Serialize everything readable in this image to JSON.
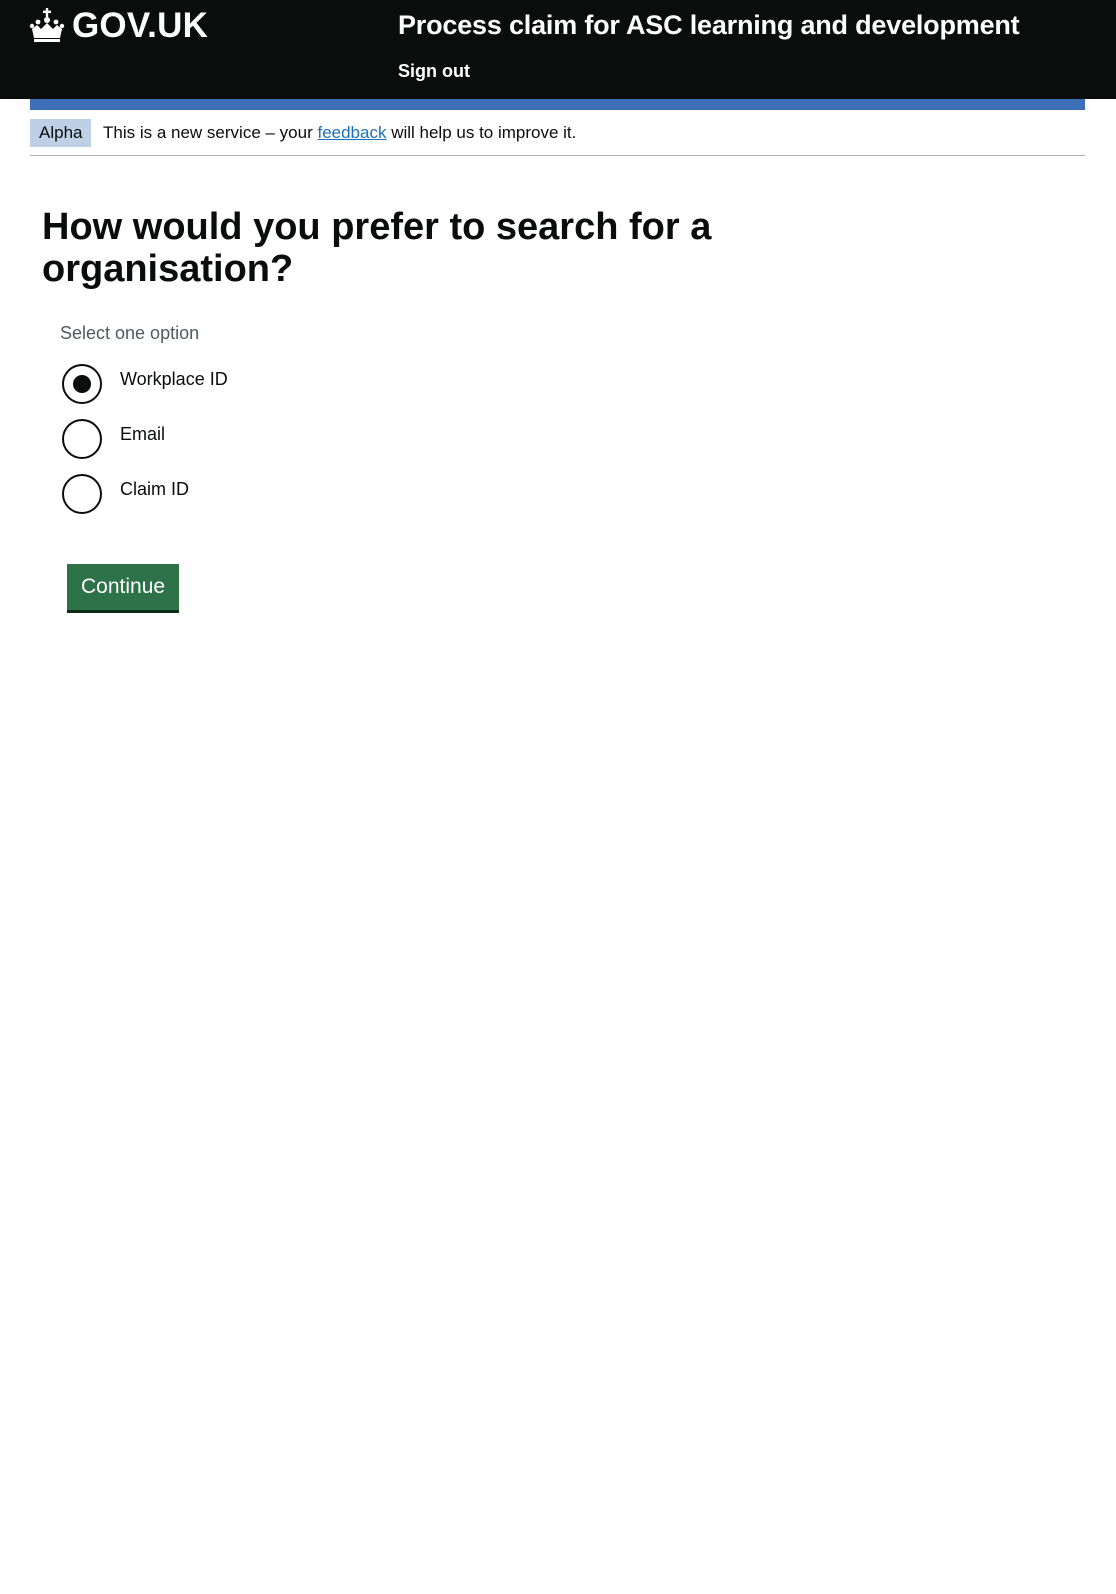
{
  "header": {
    "logo_text": "GOV.UK",
    "service_name": "Process claim for ASC learning and development",
    "sign_out_label": "Sign out"
  },
  "phase_banner": {
    "tag": "Alpha",
    "text_before": "This is a new service – your ",
    "link_text": "feedback",
    "text_after": " will help us to improve it."
  },
  "main": {
    "heading": "How would you prefer to search for a organisation?",
    "hint": "Select one option",
    "options": [
      {
        "label": "Workplace ID",
        "checked": true
      },
      {
        "label": "Email",
        "checked": false
      },
      {
        "label": "Claim ID",
        "checked": false
      }
    ],
    "continue_label": "Continue"
  },
  "colors": {
    "header_bg": "#0b0c0c",
    "blue_bar": "#3d6fb8",
    "phase_tag_bg": "#bdd0e6",
    "link": "#1d70b8",
    "button_bg": "#2d7248",
    "hint_text": "#505a5f"
  },
  "icons": {
    "logo": "crown-icon"
  }
}
